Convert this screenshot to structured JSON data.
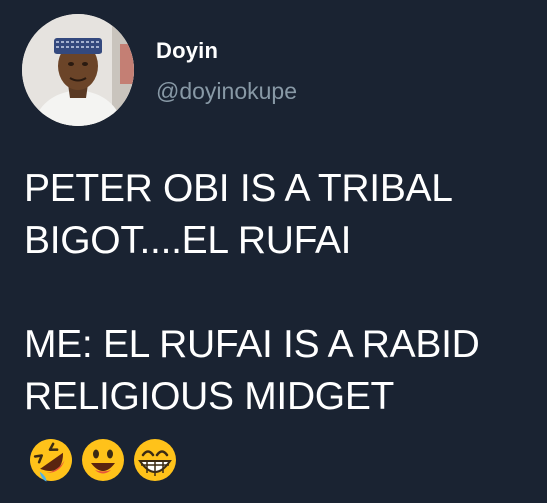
{
  "author": {
    "name": "Doyin",
    "handle": "@doyinokupe"
  },
  "tweet": {
    "lines": [
      "PETER OBI IS A TRIBAL",
      "BIGOT....EL RUFAI",
      "",
      "ME: EL RUFAI IS A RABID",
      "RELIGIOUS MIDGET"
    ],
    "emojis": [
      "rolling-on-floor-laughing",
      "smiling-face",
      "grinning-face"
    ]
  },
  "colors": {
    "background": "#1a2332",
    "text": "#ffffff",
    "handle": "#8899a6",
    "emoji_yellow": "#ffc21a"
  }
}
